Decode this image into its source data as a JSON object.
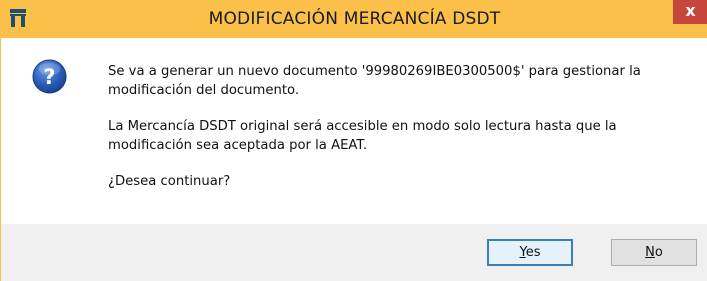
{
  "window": {
    "title": "MODIFICACIÓN MERCANCÍA DSDT",
    "close_glyph": "x"
  },
  "icons": {
    "app": "app-icon",
    "dialog": "question-icon",
    "close": "close-icon"
  },
  "message": {
    "line1": "Se va a generar un nuevo documento '99980269IBE0300500$' para gestionar la modificación del documento.",
    "line2": "La Mercancía DSDT original será accesible en modo solo lectura hasta que la modificación sea aceptada por la AEAT.",
    "line3": "¿Desea continuar?"
  },
  "buttons": {
    "yes_accel": "Y",
    "yes_rest": "es",
    "no_accel": "N",
    "no_rest": "o"
  },
  "colors": {
    "titlebar": "#fbc04a",
    "close": "#c7463c",
    "icon_blue": "#2a5db8",
    "buttonbar": "#f0f0f0"
  }
}
